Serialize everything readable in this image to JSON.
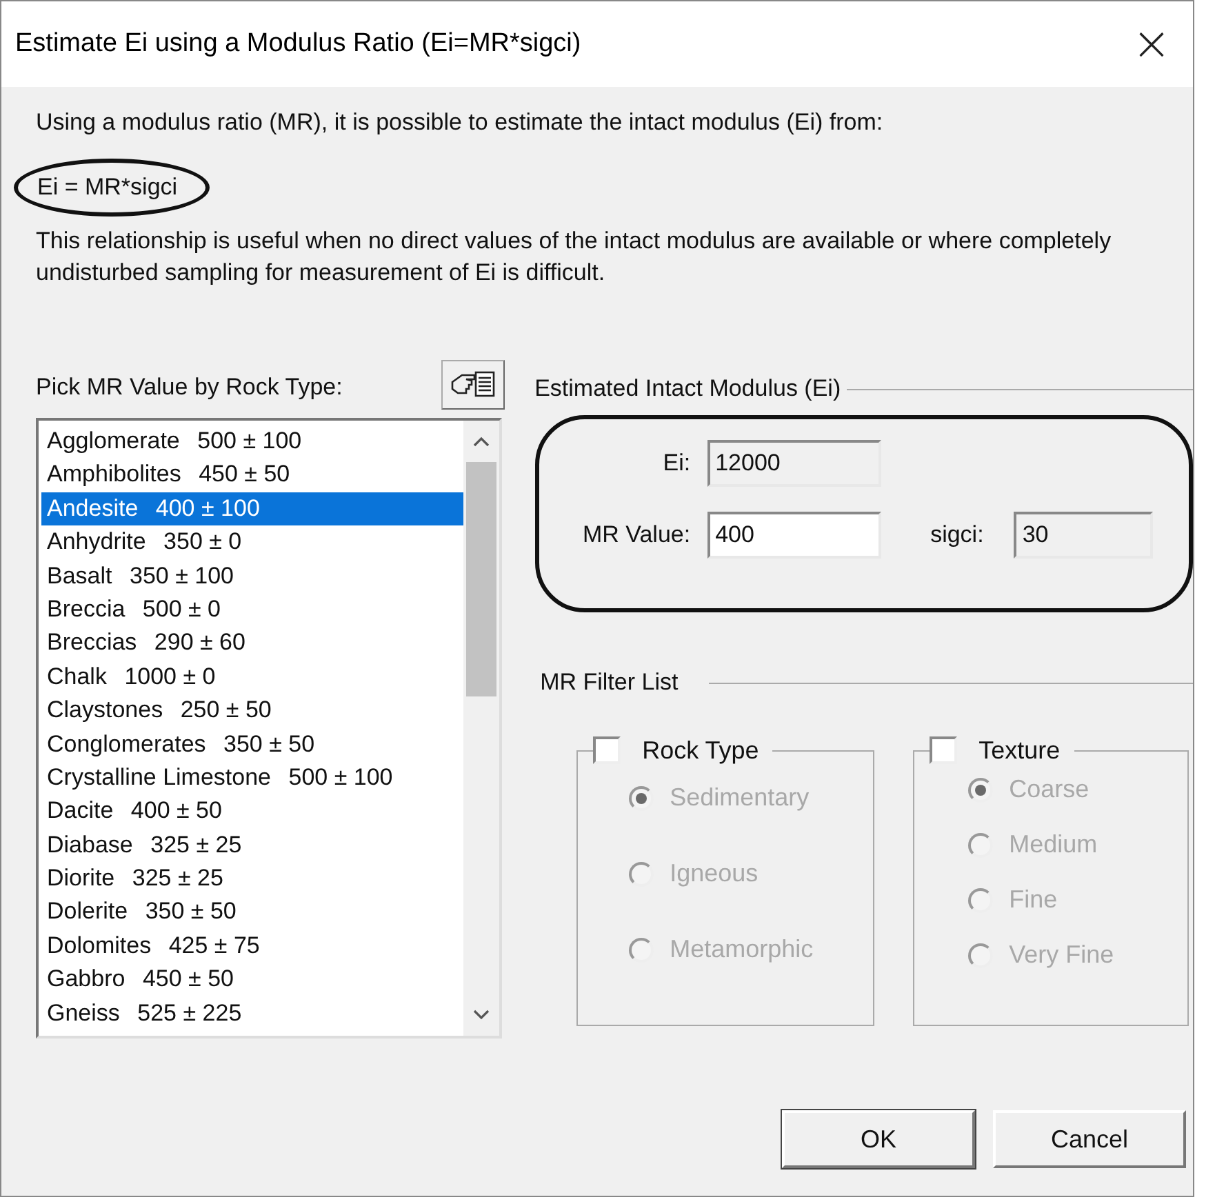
{
  "window": {
    "title": "Estimate Ei using a Modulus Ratio (Ei=MR*sigci)",
    "close": "×"
  },
  "intro": "Using a modulus ratio (MR), it is possible to estimate the intact modulus (Ei) from:",
  "formula": "Ei = MR*sigci",
  "note": "This relationship is useful when no direct values of the intact modulus are available or where completely undisturbed sampling for measurement of Ei is difficult.",
  "rock_list": {
    "label": "Pick MR Value by Rock Type:",
    "items": [
      {
        "name": "Agglomerate",
        "value": "500 ± 100",
        "selected": false
      },
      {
        "name": "Amphibolites",
        "value": "450 ± 50",
        "selected": false
      },
      {
        "name": "Andesite",
        "value": "400 ± 100",
        "selected": true
      },
      {
        "name": "Anhydrite",
        "value": "350 ± 0",
        "selected": false
      },
      {
        "name": "Basalt",
        "value": "350 ± 100",
        "selected": false
      },
      {
        "name": "Breccia",
        "value": "500 ± 0",
        "selected": false
      },
      {
        "name": "Breccias",
        "value": "290 ± 60",
        "selected": false
      },
      {
        "name": "Chalk",
        "value": "1000 ± 0",
        "selected": false
      },
      {
        "name": "Claystones",
        "value": "250 ± 50",
        "selected": false
      },
      {
        "name": "Conglomerates",
        "value": "350 ± 50",
        "selected": false
      },
      {
        "name": "Crystalline Limestone",
        "value": "500 ± 100",
        "selected": false
      },
      {
        "name": "Dacite",
        "value": "400 ± 50",
        "selected": false
      },
      {
        "name": "Diabase",
        "value": "325 ± 25",
        "selected": false
      },
      {
        "name": "Diorite",
        "value": "325 ± 25",
        "selected": false
      },
      {
        "name": "Dolerite",
        "value": "350 ± 50",
        "selected": false
      },
      {
        "name": "Dolomites",
        "value": "425 ± 75",
        "selected": false
      },
      {
        "name": "Gabbro",
        "value": "450 ± 50",
        "selected": false
      },
      {
        "name": "Gneiss",
        "value": "525 ± 225",
        "selected": false
      }
    ]
  },
  "estimate": {
    "title": "Estimated Intact Modulus (Ei)",
    "ei": {
      "label": "Ei:",
      "value": "12000",
      "readonly": true
    },
    "mr": {
      "label": "MR Value:",
      "value": "400",
      "readonly": false
    },
    "sigci": {
      "label": "sigci:",
      "value": "30",
      "readonly": true
    }
  },
  "filter": {
    "title": "MR Filter List",
    "groups": [
      {
        "label": "Rock Type",
        "checked": false,
        "options": [
          {
            "label": "Sedimentary",
            "selected": true
          },
          {
            "label": "Igneous",
            "selected": false
          },
          {
            "label": "Metamorphic",
            "selected": false
          }
        ]
      },
      {
        "label": "Texture",
        "checked": false,
        "options": [
          {
            "label": "Coarse",
            "selected": true
          },
          {
            "label": "Medium",
            "selected": false
          },
          {
            "label": "Fine",
            "selected": false
          },
          {
            "label": "Very Fine",
            "selected": false
          }
        ]
      }
    ]
  },
  "buttons": [
    {
      "label": "OK",
      "default": true
    },
    {
      "label": "Cancel",
      "default": false
    }
  ]
}
